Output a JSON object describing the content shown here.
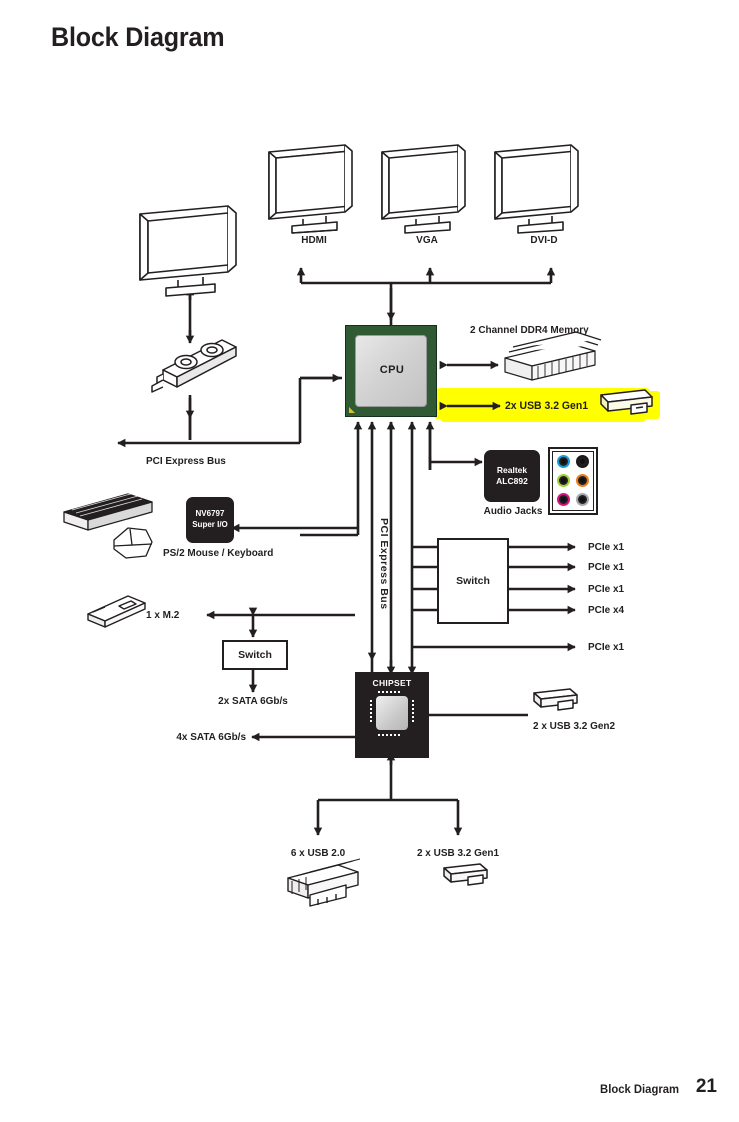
{
  "page": {
    "title": "Block Diagram",
    "footer_label": "Block Diagram",
    "footer_page": "21"
  },
  "colors": {
    "ink": "#231f20",
    "highlight": "#ffff00",
    "cpu_substrate": "#2f5a34",
    "chip_black": "#231f20",
    "jack_blue": "#1b9ad6",
    "jack_black": "#1a1a1a",
    "jack_green": "#a5cd39",
    "jack_orange": "#e87d1e",
    "jack_pink": "#d4147f",
    "jack_gray": "#a7a9ac"
  },
  "diagram": {
    "displays": [
      {
        "label": "HDMI",
        "icon": "monitor-icon"
      },
      {
        "label": "VGA",
        "icon": "monitor-icon"
      },
      {
        "label": "DVI-D",
        "icon": "monitor-icon"
      }
    ],
    "gpu_monitor": {
      "icon": "monitor-icon"
    },
    "graphics_card": {
      "icon": "graphics-card-icon"
    },
    "cpu": {
      "label": "CPU"
    },
    "memory": {
      "label": "2 Channel DDR4 Memory",
      "icon": "dimm-icon"
    },
    "cpu_usb": {
      "label": "2x USB 3.2 Gen1",
      "icon": "usb-flash-icon",
      "highlighted": true
    },
    "audio_codec": {
      "line1": "Realtek",
      "line2": "ALC892"
    },
    "audio_jacks": {
      "label": "Audio Jacks",
      "jacks": [
        {
          "name": "line-in-jack",
          "color": "#1b9ad6"
        },
        {
          "name": "line-out-jack",
          "color": "#1a1a1a"
        },
        {
          "name": "mic-jack",
          "color": "#a5cd39"
        },
        {
          "name": "center-sub-jack",
          "color": "#e87d1e"
        },
        {
          "name": "rear-speaker-jack",
          "color": "#d4147f"
        },
        {
          "name": "side-speaker-jack",
          "color": "#a7a9ac"
        }
      ]
    },
    "super_io": {
      "line1": "NV6797",
      "line2": "Super I/O"
    },
    "ps2": {
      "label": "PS/2 Mouse / Keyboard",
      "icon": "keyboard-mouse-icon"
    },
    "pci_express_bus_label": "PCI Express Bus",
    "pci_express_bus_vertical": "PCI Express Bus",
    "pcie_switch": {
      "label": "Switch"
    },
    "pcie_lanes": [
      {
        "label": "PCIe x1"
      },
      {
        "label": "PCIe x1"
      },
      {
        "label": "PCIe x1"
      },
      {
        "label": "PCIe x4"
      }
    ],
    "pcie_direct_lane": {
      "label": "PCIe x1"
    },
    "m2": {
      "label": "1 x M.2",
      "icon": "m2-ssd-icon"
    },
    "sata_switch": {
      "label": "Switch"
    },
    "sata_2x": {
      "label": "2x SATA 6Gb/s"
    },
    "sata_4x": {
      "label": "4x SATA 6Gb/s"
    },
    "chipset": {
      "label": "CHIPSET"
    },
    "chipset_usb_gen2": {
      "label": "2 x USB 3.2 Gen2",
      "icon": "usb-flash-icon"
    },
    "chipset_usb20": {
      "label": "6 x USB 2.0",
      "icon": "usb-ports-icon"
    },
    "chipset_usb_gen1": {
      "label": "2 x USB 3.2 Gen1",
      "icon": "usb-flash-icon"
    }
  }
}
